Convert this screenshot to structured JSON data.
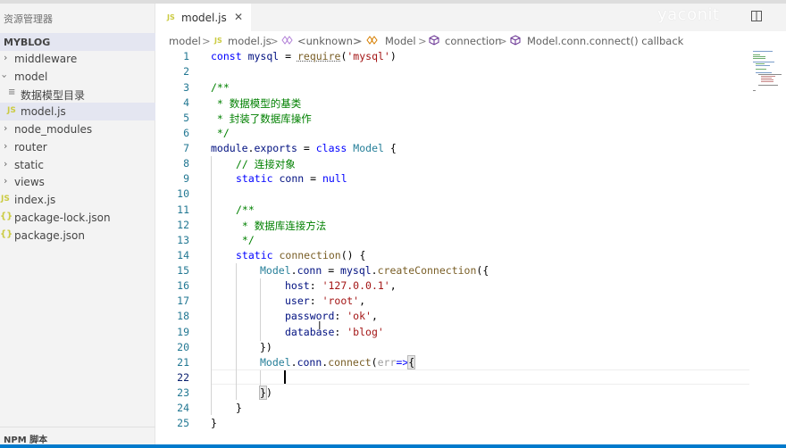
{
  "sidebar": {
    "title": "资源管理器",
    "section": "MYBLOG",
    "items": [
      {
        "label": "middleware",
        "type": "folder",
        "expanded": false
      },
      {
        "label": "model",
        "type": "folder",
        "expanded": true
      },
      {
        "label": "数据模型目录",
        "type": "markdown"
      },
      {
        "label": "model.js",
        "type": "js",
        "selected": true
      },
      {
        "label": "node_modules",
        "type": "folder",
        "expanded": false
      },
      {
        "label": "router",
        "type": "folder",
        "expanded": false
      },
      {
        "label": "static",
        "type": "folder",
        "expanded": false
      },
      {
        "label": "views",
        "type": "folder",
        "expanded": false
      },
      {
        "label": "index.js",
        "type": "js"
      },
      {
        "label": "package-lock.json",
        "type": "json"
      },
      {
        "label": "package.json",
        "type": "json"
      }
    ],
    "npm_section": "NPM 脚本"
  },
  "tab": {
    "icon": "JS",
    "label": "model.js",
    "close": "✕"
  },
  "watermark": "yaconit",
  "breadcrumb": {
    "items": [
      "model",
      "model.js",
      "<unknown>",
      "Model",
      "connection",
      "Model.conn.connect() callback"
    ],
    "separator": ">"
  },
  "editor": {
    "line_numbers": [
      "1",
      "2",
      "3",
      "4",
      "5",
      "6",
      "7",
      "8",
      "9",
      "10",
      "11",
      "12",
      "13",
      "14",
      "15",
      "16",
      "17",
      "18",
      "19",
      "20",
      "21",
      "22",
      "23",
      "24",
      "25"
    ],
    "tokens": {
      "l1": [
        "const",
        "mysql",
        " = ",
        "require",
        "(",
        "'mysql'",
        ")"
      ],
      "l3": "/**",
      "l4": " * 数据模型的基类",
      "l5": " * 封装了数据库操作",
      "l6": " */",
      "l7": [
        "module",
        ".",
        "exports",
        " = ",
        "class",
        " ",
        "Model",
        " {"
      ],
      "l8": "// 连接对象",
      "l9": [
        "static",
        " ",
        "conn",
        " = ",
        "null"
      ],
      "l11": "/**",
      "l12": " * 数据库连接方法",
      "l13": " */",
      "l14": [
        "static",
        " ",
        "connection",
        "() {"
      ],
      "l15": [
        "Model",
        ".",
        "conn",
        " = ",
        "mysql",
        ".",
        "createConnection",
        "({"
      ],
      "l16": [
        "host",
        ": ",
        "'127.0.0.1'",
        ","
      ],
      "l17": [
        "user",
        ": ",
        "'root'",
        ","
      ],
      "l18": [
        "password",
        ": ",
        "'ok'",
        ","
      ],
      "l19": [
        "database",
        ": ",
        "'blog'"
      ],
      "l20": "})",
      "l21": [
        "Model",
        ".",
        "conn",
        ".",
        "connect",
        "(",
        "err",
        "=>",
        "{"
      ],
      "l23": [
        "}",
        ")"
      ],
      "l24": "}",
      "l25": "}"
    }
  },
  "colors": {
    "keyword": "#0000ff",
    "string": "#a31515",
    "comment": "#008000",
    "function": "#795e26",
    "variable": "#001080",
    "class": "#267f99",
    "line_number": "#237893",
    "status_bar": "#007acc"
  }
}
